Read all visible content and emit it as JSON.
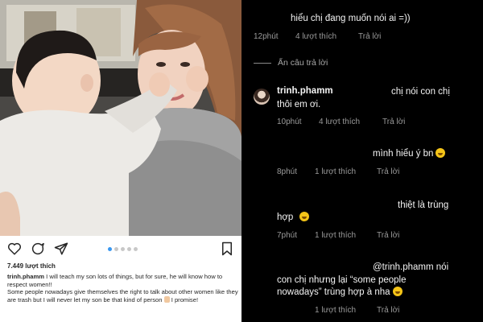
{
  "post": {
    "likes": "7.449 lượt thích",
    "caption_user": "trinh.phamm",
    "caption_text": " I will teach my son lots of things, but for sure, he will know how to respect women!!",
    "caption_text_2": "Some people nowadays give themselves the right to talk about other women like they are trash but I will never let my son be that kind of person",
    "caption_text_3": " I promise!",
    "icons": [
      "heart-icon",
      "comment-icon",
      "share-icon",
      "bookmark-icon"
    ],
    "carousel": {
      "total": 5,
      "active": 0
    }
  },
  "thread": {
    "comment1": {
      "text": "hiểu chị đang muốn nói ai =))",
      "time": "12phút",
      "likes": "4 lượt thích",
      "reply": "Trả lời"
    },
    "hide_replies": "Ẩn câu trả lời",
    "comment2": {
      "user": "trinh.phamm",
      "text_line1": "chị nói con chị",
      "text_line2": "thôi em ơi.",
      "time": "10phút",
      "likes": "4 lượt thích",
      "reply": "Trả lời"
    },
    "comment3": {
      "text": "mình hiểu ý bn",
      "time": "8phút",
      "likes": "1 lượt thích",
      "reply": "Trả lời"
    },
    "comment4": {
      "text_line1": "thiệt là trùng",
      "text_line2": "hợp",
      "time": "7phút",
      "likes": "1 lượt thích",
      "reply": "Trả lời"
    },
    "comment5": {
      "text_line1": "@trinh.phamm nói",
      "text_line2": "con chị nhưng lại “some people",
      "text_line3": "nowadays” trùng hợp à nha",
      "likes": "1 lượt thích",
      "reply": "Trả lời"
    }
  },
  "colors": {
    "link_blue": "#3897f0",
    "dark_bg": "#000000",
    "muted": "#9a9a9a",
    "emoji_yellow": "#f5c518"
  }
}
